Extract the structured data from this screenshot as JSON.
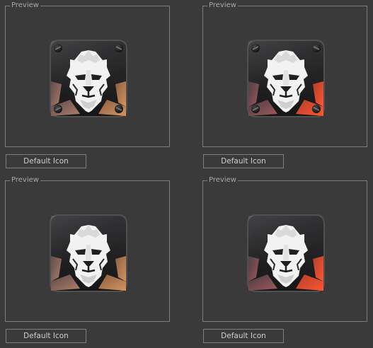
{
  "panels": [
    {
      "legend": "Preview",
      "button_label": "Default Icon",
      "icon": "lion-app-icon-with-screws",
      "accent_color": "#b87a5a"
    },
    {
      "legend": "Preview",
      "button_label": "Default Icon",
      "icon": "lion-app-icon-with-screws",
      "accent_color": "#e8502e"
    },
    {
      "legend": "Preview",
      "button_label": "Default Icon",
      "icon": "lion-app-icon",
      "accent_color": "#c98a5c"
    },
    {
      "legend": "Preview",
      "button_label": "Default Icon",
      "icon": "lion-app-icon",
      "accent_color": "#ee4a2c"
    }
  ]
}
